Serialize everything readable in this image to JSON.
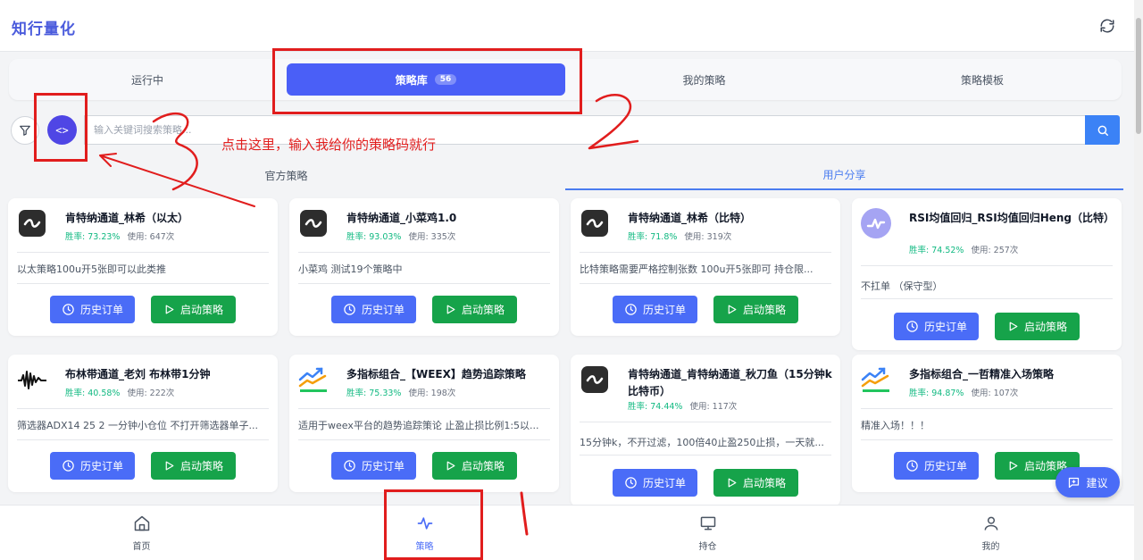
{
  "header": {
    "title": "知行量化",
    "refresh_icon": "refresh-icon"
  },
  "tabs": [
    {
      "label": "运行中"
    },
    {
      "label": "策略库",
      "badge": "56",
      "active": true
    },
    {
      "label": "我的策略"
    },
    {
      "label": "策略模板"
    }
  ],
  "search": {
    "placeholder": "输入关键词搜索策略..."
  },
  "subtabs": [
    {
      "label": "官方策略"
    },
    {
      "label": "用户分享",
      "active": true
    }
  ],
  "buttons": {
    "history": "历史订单",
    "start": "启动策略"
  },
  "cards": [
    {
      "title": "肯特纳通道_林希（以太）",
      "winrate": "胜率: 73.23%",
      "usage": "使用: 647次",
      "desc": "以太策略100u开5张即可以此类推",
      "icon": "wave-icon"
    },
    {
      "title": "肯特纳通道_小菜鸡1.0",
      "winrate": "胜率: 93.03%",
      "usage": "使用: 335次",
      "desc": "小菜鸡 测试19个策略中",
      "icon": "wave-icon"
    },
    {
      "title": "肯特纳通道_林希（比特）",
      "winrate": "胜率: 71.8%",
      "usage": "使用: 319次",
      "desc": "比特策略需要严格控制张数 100u开5张即可 持仓限...",
      "icon": "wave-icon"
    },
    {
      "title": "RSI均值回归_RSI均值回归Heng（比特）",
      "winrate": "胜率: 74.52%",
      "usage": "使用: 257次",
      "desc": "不扛单 （保守型）",
      "icon": "pulse-circle-icon"
    },
    {
      "title": "布林带通道_老刘 布林带1分钟",
      "winrate": "胜率: 40.58%",
      "usage": "使用: 222次",
      "desc": "筛选器ADX14 25 2 一分钟小仓位 不打开筛选器单子...",
      "icon": "heartbeat-icon"
    },
    {
      "title": "多指标组合_【WEEX】趋势追踪策略",
      "winrate": "胜率: 75.33%",
      "usage": "使用: 198次",
      "desc": "适用于weex平台的趋势追踪策论 止盈止损比例1:5以...",
      "icon": "trend-chart-icon"
    },
    {
      "title": "肯特纳通道_肯特纳通道_秋刀鱼（15分钟k比特币）",
      "winrate": "胜率: 74.44%",
      "usage": "使用: 117次",
      "desc": "15分钟k，不开过滤，100倍40止盈250止损，一天就...",
      "icon": "wave-icon"
    },
    {
      "title": "多指标组合_一哲精准入场策略",
      "winrate": "胜率: 94.87%",
      "usage": "使用: 107次",
      "desc": "精准入场！！！",
      "icon": "trend-chart-icon"
    }
  ],
  "suggest": {
    "label": "建议"
  },
  "bottom_nav": [
    {
      "label": "首页",
      "icon": "home-icon"
    },
    {
      "label": "策略",
      "icon": "activity-icon",
      "active": true
    },
    {
      "label": "持仓",
      "icon": "monitor-icon"
    },
    {
      "label": "我的",
      "icon": "user-icon"
    }
  ],
  "annotation": {
    "text": "点击这里，输入我给你的策略码就行"
  },
  "colors": {
    "primary": "#4a6cf7",
    "success": "#16a34a",
    "winrate": "#10b981",
    "annotation": "#e11d1d"
  }
}
